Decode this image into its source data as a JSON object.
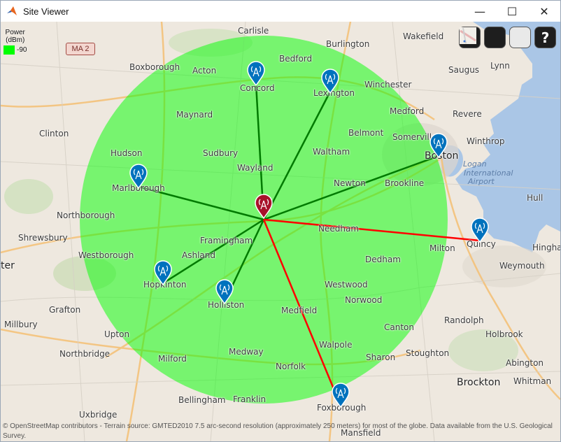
{
  "window": {
    "title": "Site Viewer",
    "minimize": "—",
    "maximize": "☐",
    "close": "✕"
  },
  "toolbar": {
    "home_icon": "home-icon",
    "globe_icon": "globe-icon",
    "basemap_icon": "basemap-picker-icon",
    "help_label": "?"
  },
  "legend": {
    "title_line1": "Power",
    "title_line2": "(dBm)",
    "value": "-90",
    "color": "#00ff00"
  },
  "colors": {
    "coverage": "#00ff00",
    "link_success": "#007a00",
    "link_fail": "#ff0000",
    "tx_pin": "#a8112a",
    "rx_pin": "#0072bd"
  },
  "road_shield": "MA 2",
  "places": [
    "Carlisle",
    "Wakefield",
    "Burlington",
    "Bedford",
    "Acton",
    "Boxborough",
    "Concord",
    "Lexington",
    "Winchester",
    "Saugus",
    "Lynn",
    "Maynard",
    "Medford",
    "Revere",
    "Clinton",
    "Belmont",
    "Somerville",
    "Winthrop",
    "Hudson",
    "Sudbury",
    "Waltham",
    "Boston",
    "Wayland",
    "Marlborough",
    "Newton",
    "Brookline",
    "Hull",
    "Northborough",
    "Shrewsbury",
    "Needham",
    "Quincy",
    "Framingham",
    "Milton",
    "Hingha",
    "Westborough",
    "Ashland",
    "Weymouth",
    "ter",
    "Dedham",
    "Hopkinton",
    "Westwood",
    "Holliston",
    "Norwood",
    "Grafton",
    "Randolph",
    "Millbury",
    "Medfield",
    "Canton",
    "Upton",
    "Holbrook",
    "Walpole",
    "Northbridge",
    "Stoughton",
    "Sharon",
    "Milford",
    "Medway",
    "Abington",
    "Norfolk",
    "Brockton",
    "Whitman",
    "Bellingham",
    "Franklin",
    "Uxbridge",
    "Foxborough",
    "Mansfield"
  ],
  "water_labels": [
    "Logan",
    "International",
    "Airport"
  ],
  "attribution": "© OpenStreetMap contributors - Terrain source: GMTED2010 7.5 arc-second resolution (approximately 250 meters) for most of the globe. Data available from the U.S. Geological Survey."
}
